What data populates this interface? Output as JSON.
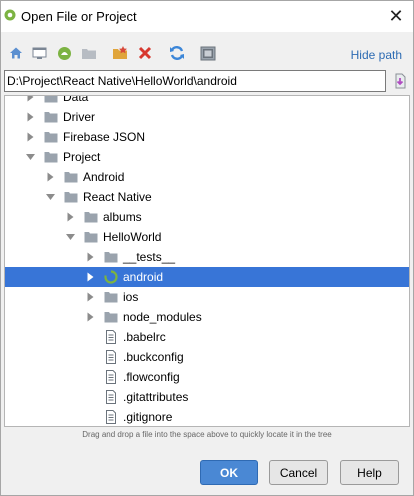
{
  "window": {
    "title": "Open File or Project",
    "close_glyph": "✕"
  },
  "toolbar": {
    "icons": [
      "home-icon",
      "desktop-icon",
      "android-project-icon",
      "module-folder-icon",
      "new-folder-icon",
      "delete-icon",
      "refresh-icon",
      "show-hidden-icon"
    ],
    "hide_path_label": "Hide path"
  },
  "path": {
    "value": "D:\\Project\\React Native\\HelloWorld\\android"
  },
  "tree": {
    "rows": [
      {
        "label": "Data",
        "kind": "folder",
        "state": "collapsed"
      },
      {
        "label": "Driver",
        "kind": "folder",
        "state": "collapsed"
      },
      {
        "label": "Firebase JSON",
        "kind": "folder",
        "state": "collapsed"
      },
      {
        "label": "Project",
        "kind": "folder",
        "state": "expanded"
      },
      {
        "label": "Android",
        "kind": "folder",
        "state": "collapsed"
      },
      {
        "label": "React Native",
        "kind": "folder",
        "state": "expanded"
      },
      {
        "label": "albums",
        "kind": "folder",
        "state": "collapsed"
      },
      {
        "label": "HelloWorld",
        "kind": "folder",
        "state": "expanded"
      },
      {
        "label": "__tests__",
        "kind": "folder",
        "state": "collapsed"
      },
      {
        "label": "android",
        "kind": "loading",
        "state": "collapsed",
        "selected": true
      },
      {
        "label": "ios",
        "kind": "folder",
        "state": "collapsed"
      },
      {
        "label": "node_modules",
        "kind": "folder",
        "state": "collapsed"
      },
      {
        "label": ".babelrc",
        "kind": "file"
      },
      {
        "label": ".buckconfig",
        "kind": "file"
      },
      {
        "label": ".flowconfig",
        "kind": "file"
      },
      {
        "label": ".gitattributes",
        "kind": "file"
      },
      {
        "label": ".gitignore",
        "kind": "file"
      }
    ]
  },
  "hint": "Drag and drop a file into the space above to quickly locate it in the tree",
  "buttons": {
    "ok": "OK",
    "cancel": "Cancel",
    "help": "Help"
  },
  "colors": {
    "selection": "#3875d7",
    "accent": "#2d6bb3",
    "ok_button": "#4a88d4",
    "folder": "#9aa3ad",
    "android_green": "#7cb342"
  }
}
